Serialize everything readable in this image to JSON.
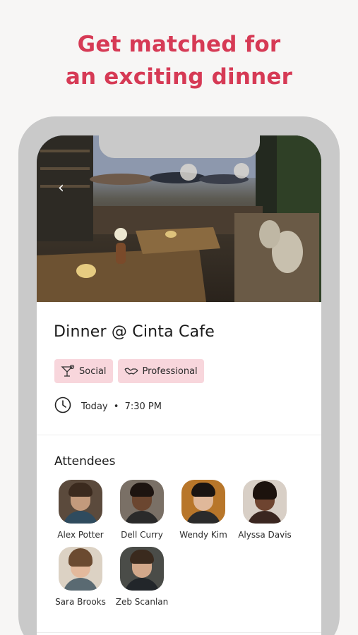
{
  "headline": {
    "line1": "Get matched for",
    "line2": "an exciting dinner"
  },
  "event": {
    "title": "Dinner @ Cinta Cafe",
    "tags": [
      {
        "label": "Social",
        "icon": "cocktail-icon"
      },
      {
        "label": "Professional",
        "icon": "handshake-icon"
      }
    ],
    "day": "Today",
    "separator": "•",
    "time": "7:30 PM"
  },
  "attendees": {
    "title": "Attendees",
    "people": [
      {
        "name": "Alex Potter"
      },
      {
        "name": "Dell Curry"
      },
      {
        "name": "Wendy Kim"
      },
      {
        "name": "Alyssa Davis"
      },
      {
        "name": "Sara Brooks"
      },
      {
        "name": "Zeb Scanlan"
      }
    ]
  },
  "colors": {
    "accent": "#d63a55",
    "tag_bg": "#f8d6dc",
    "phone_frame": "#c9c9c9"
  }
}
